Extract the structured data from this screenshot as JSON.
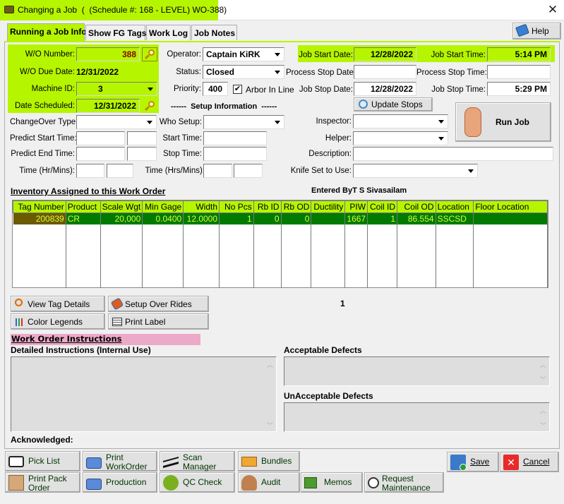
{
  "window": {
    "title": "Changing a Job  (  (Schedule #: 168 - LEVEL) WO-388)",
    "close_label": "✕"
  },
  "tabs": [
    {
      "label": "Running a Job Info",
      "active": true
    },
    {
      "label": "Show FG Tags",
      "active": false
    },
    {
      "label": "Work Log",
      "active": false
    },
    {
      "label": "Job Notes",
      "active": false
    }
  ],
  "help_label": "Help",
  "job_info": {
    "wo_number_label": "W/O Number:",
    "wo_number": "388",
    "wo_due_date_label": "W/O Due Date:",
    "wo_due_date": "12/31/2022",
    "machine_id_label": "Machine ID:",
    "machine_id": "3",
    "date_scheduled_label": "Date Scheduled:",
    "date_scheduled": "12/31/2022",
    "operator_label": "Operator:",
    "operator": "Captain KiRK",
    "status_label": "Status:",
    "status": "Closed",
    "priority_label": "Priority:",
    "priority": "400",
    "arbor_in_line_label": "Arbor In Line",
    "arbor_in_line_checked": "✔",
    "job_start_date_label": "Job Start Date:",
    "job_start_date": "12/28/2022",
    "job_start_time_label": "Job Start Time:",
    "job_start_time": "5:14 PM",
    "process_stop_date_label": "Process Stop Date",
    "process_stop_date": "",
    "process_stop_time_label": "Process Stop Time:",
    "process_stop_time": "",
    "job_stop_date_label": "Job Stop Date:",
    "job_stop_date": "12/28/2022",
    "job_stop_time_label": "Job Stop Time:",
    "job_stop_time": "5:29 PM",
    "update_stops_label": "Update Stops",
    "run_job_label": "Run Job"
  },
  "setup": {
    "header": "------  Setup Information  ------",
    "changeover_type_label": "ChangeOver Type:",
    "changeover_type": "",
    "predict_start_label": "Predict Start Time:",
    "predict_end_label": "Predict End Time:",
    "time_hr_mins_label": "Time (Hr/Mins):",
    "who_setup_label": "Who Setup:",
    "who_setup": "",
    "start_time_label": "Start Time:",
    "stop_time_label": "Stop Time:",
    "time_hrs_mins_label": "Time (Hrs/Mins):",
    "inspector_label": "Inspector:",
    "inspector": "",
    "helper_label": "Helper:",
    "helper": "",
    "description_label": "Description:",
    "description": "",
    "knife_set_label": "Knife Set to Use:",
    "knife_set": ""
  },
  "inventory": {
    "title": "Inventory Assigned to this Work Order",
    "entered_by": "Entered ByT S Sivasailam",
    "columns": [
      "Tag Number",
      "Product",
      "Scale Wgt",
      "Min Gage",
      "Width",
      "No Pcs",
      "Rb ID",
      "Rb OD",
      "Ductility",
      "PIW",
      "Coil ID",
      "Coil OD",
      "Location",
      "Floor Location"
    ],
    "rows": [
      [
        "200839",
        "CR",
        "20,000",
        "0.0400",
        "12.0000",
        "1",
        "0",
        "0",
        "",
        "1667",
        "1",
        "86.554",
        "SSCSD",
        ""
      ]
    ],
    "row_count": "1"
  },
  "actions": {
    "view_tag_details": "View Tag Details",
    "setup_over_rides": "Setup Over Rides",
    "color_legends": "Color Legends",
    "print_label": "Print Label"
  },
  "instructions": {
    "title": "Work Order Instructions",
    "detailed_label": "Detailed Instructions (Internal Use)",
    "detailed_value": "",
    "acceptable_label": "Acceptable Defects",
    "acceptable_value": "",
    "unacceptable_label": "UnAcceptable Defects",
    "unacceptable_value": "",
    "acknowledged_label": "Acknowledged:"
  },
  "bottom_buttons": {
    "pick_list": "Pick List",
    "print_workorder_1": "Print",
    "print_workorder_2": "WorkOrder",
    "scan_manager_1": "Scan",
    "scan_manager_2": "Manager",
    "bundles": "Bundles",
    "print_pack_order_1": "Print Pack",
    "print_pack_order_2": "Order",
    "production": "Production",
    "qc_check": "QC Check",
    "audit": "Audit",
    "memos": "Memos",
    "request_maintenance_1": "Request",
    "request_maintenance_2": "Maintenance",
    "save": "Save",
    "cancel": "Cancel"
  },
  "colors": {
    "highlight": "#b6f500",
    "selected_row": "#007a00",
    "selected_text": "#d7ff3a",
    "instructions_header": "#ecaac8"
  }
}
